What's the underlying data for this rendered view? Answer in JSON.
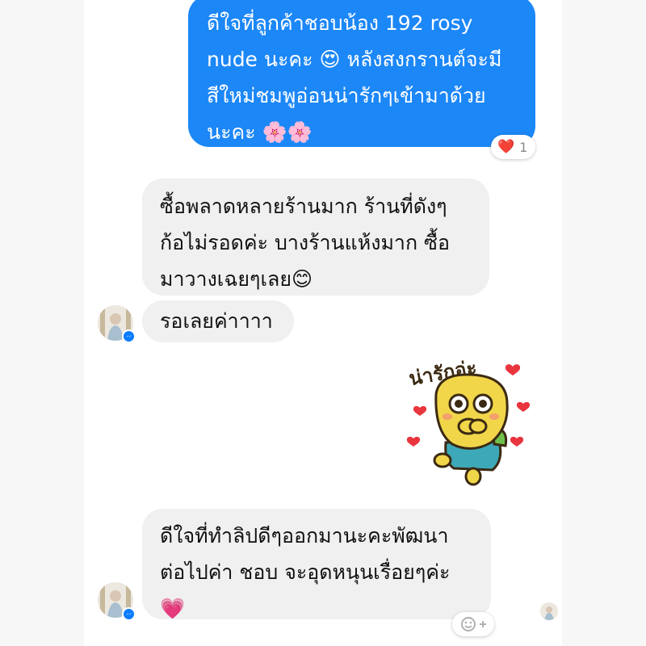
{
  "messages": [
    {
      "id": "m1",
      "direction": "outgoing",
      "text": "ดีใจที่ลูกค้าชอบน้อง 192 rosy\nnude นะคะ 😍 หลังสงกรานต์จะมี\nสีใหม่ชมพูอ่อนน่ารักๆเข้ามาด้วย\nนะคะ 🌸🌸",
      "reaction": {
        "emoji": "❤️",
        "count": "1"
      }
    },
    {
      "id": "m2",
      "direction": "incoming",
      "text": "ซื้อพลาดหลายร้านมาก ร้านที่ดังๆ\nก้อไม่รอดค่ะ บางร้านแห้งมาก ซื้อ\nมาวางเฉยๆเลย😊"
    },
    {
      "id": "m3",
      "direction": "incoming",
      "text": "รอเลยค่าาาา"
    },
    {
      "id": "m4",
      "direction": "outgoing",
      "type": "sticker",
      "caption": "น่ารักอ่ะ"
    },
    {
      "id": "m5",
      "direction": "incoming",
      "text": "ดีใจที่ทำลิปดีๆออกมานะคะพัฒนา\nต่อไปค่า ชอบ จะอุดหนุนเรื่อยๆค่ะ\n💗"
    }
  ],
  "colors": {
    "outgoing_bubble": "#1c87f7",
    "incoming_bubble": "#f0f0f0",
    "messenger_badge": "#0a7cff"
  },
  "icons": {
    "reaction": "heart-icon",
    "badge": "messenger-icon",
    "add_reaction": "add-emoji-icon"
  }
}
